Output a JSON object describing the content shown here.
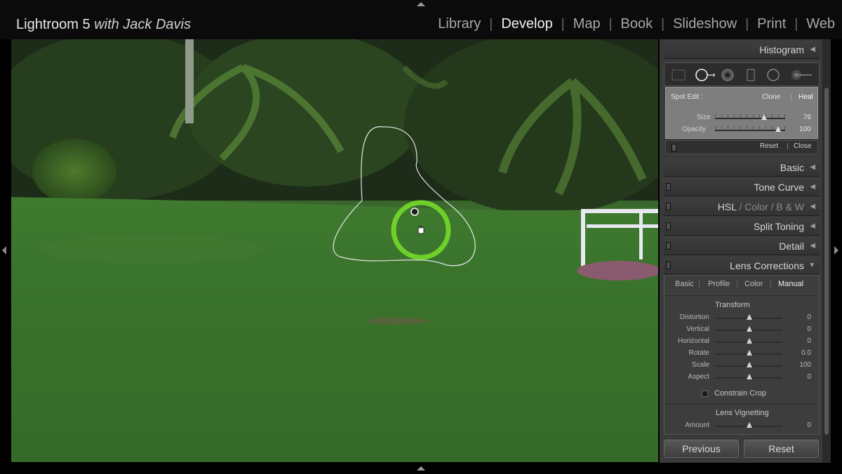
{
  "app": {
    "brand_main": "Lightroom 5",
    "brand_sub": "with Jack Davis"
  },
  "modules": [
    {
      "label": "Library",
      "active": false
    },
    {
      "label": "Develop",
      "active": true
    },
    {
      "label": "Map",
      "active": false
    },
    {
      "label": "Book",
      "active": false
    },
    {
      "label": "Slideshow",
      "active": false
    },
    {
      "label": "Print",
      "active": false
    },
    {
      "label": "Web",
      "active": false
    }
  ],
  "panels": {
    "histogram": "Histogram",
    "basic": "Basic",
    "tone_curve": "Tone Curve",
    "hsl": "HSL",
    "color": "Color",
    "bw": "B & W",
    "split_toning": "Split Toning",
    "detail": "Detail",
    "lens_corrections": "Lens Corrections"
  },
  "tools": [
    "crop-overlay-icon",
    "spot-removal-icon",
    "red-eye-icon",
    "graduated-filter-icon",
    "radial-filter-icon",
    "adjustment-brush-icon"
  ],
  "spot_edit": {
    "label": "Spot Edit :",
    "clone": "Clone",
    "heal": "Heal",
    "mode": "Heal",
    "size_label": "Size",
    "size_value": "76",
    "opacity_label": "Opacity",
    "opacity_value": "100",
    "reset": "Reset",
    "close": "Close"
  },
  "lens": {
    "tabs": [
      {
        "label": "Basic",
        "active": false
      },
      {
        "label": "Profile",
        "active": false
      },
      {
        "label": "Color",
        "active": false
      },
      {
        "label": "Manual",
        "active": true
      }
    ],
    "transform_title": "Transform",
    "rows": [
      {
        "label": "Distortion",
        "value": "0"
      },
      {
        "label": "Vertical",
        "value": "0"
      },
      {
        "label": "Horizontal",
        "value": "0"
      },
      {
        "label": "Rotate",
        "value": "0.0"
      },
      {
        "label": "Scale",
        "value": "100"
      },
      {
        "label": "Aspect",
        "value": "0"
      }
    ],
    "constrain_crop": "Constrain Crop",
    "vignetting_title": "Lens Vignetting",
    "amount_label": "Amount",
    "amount_value": "0"
  },
  "buttons": {
    "previous": "Previous",
    "reset": "Reset"
  },
  "colors": {
    "spot_ring": "#6fd02b",
    "panel_bg": "#3a3a3a"
  }
}
